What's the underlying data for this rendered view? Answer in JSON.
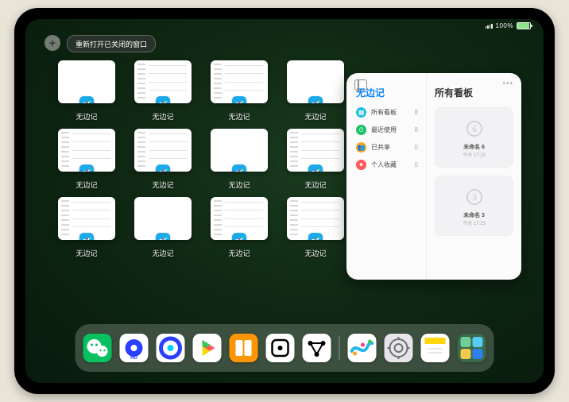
{
  "status": {
    "battery_pct": "100%"
  },
  "controls": {
    "plus_label": "+",
    "reopen_label": "重新打开已关闭的窗口"
  },
  "windows": [
    {
      "label": "无边记",
      "thumb": "blank"
    },
    {
      "label": "无边记",
      "thumb": "cal"
    },
    {
      "label": "无边记",
      "thumb": "cal"
    },
    {
      "label": "无边记",
      "thumb": "blank"
    },
    {
      "label": "无边记",
      "thumb": "cal"
    },
    {
      "label": "无边记",
      "thumb": "cal"
    },
    {
      "label": "无边记",
      "thumb": "blank"
    },
    {
      "label": "无边记",
      "thumb": "cal"
    },
    {
      "label": "无边记",
      "thumb": "cal"
    },
    {
      "label": "无边记",
      "thumb": "blank"
    },
    {
      "label": "无边记",
      "thumb": "cal"
    },
    {
      "label": "无边记",
      "thumb": "cal"
    }
  ],
  "stage": {
    "left_title": "无边记",
    "right_title": "所有看板",
    "rows": [
      {
        "icon": "grid",
        "color": "#1ebedc",
        "label": "所有看板",
        "count": "8"
      },
      {
        "icon": "clock",
        "color": "#1cc06a",
        "label": "最近使用",
        "count": "8"
      },
      {
        "icon": "share",
        "color": "#f5a623",
        "label": "已共享",
        "count": "0"
      },
      {
        "icon": "heart",
        "color": "#ff5a5a",
        "label": "个人收藏",
        "count": "0"
      }
    ],
    "cards": [
      {
        "name": "未命名 6",
        "time": "今天 17:25",
        "glyph": "6"
      },
      {
        "name": "未命名 3",
        "time": "今天 17:25",
        "glyph": "3"
      }
    ]
  },
  "dock": [
    {
      "name": "wechat",
      "bg": "#07c160"
    },
    {
      "name": "quark-hd",
      "bg": "#ffffff"
    },
    {
      "name": "quark",
      "bg": "#ffffff"
    },
    {
      "name": "play",
      "bg": "#ffffff"
    },
    {
      "name": "books",
      "bg": "#ff9500"
    },
    {
      "name": "dice",
      "bg": "#ffffff"
    },
    {
      "name": "graph",
      "bg": "#ffffff"
    },
    {
      "name": "freeform",
      "bg": "#ffffff"
    },
    {
      "name": "settings",
      "bg": "#e5e5ea"
    },
    {
      "name": "notes",
      "bg": "#ffffff"
    },
    {
      "name": "folder",
      "bg": "#3a6a4a"
    }
  ]
}
